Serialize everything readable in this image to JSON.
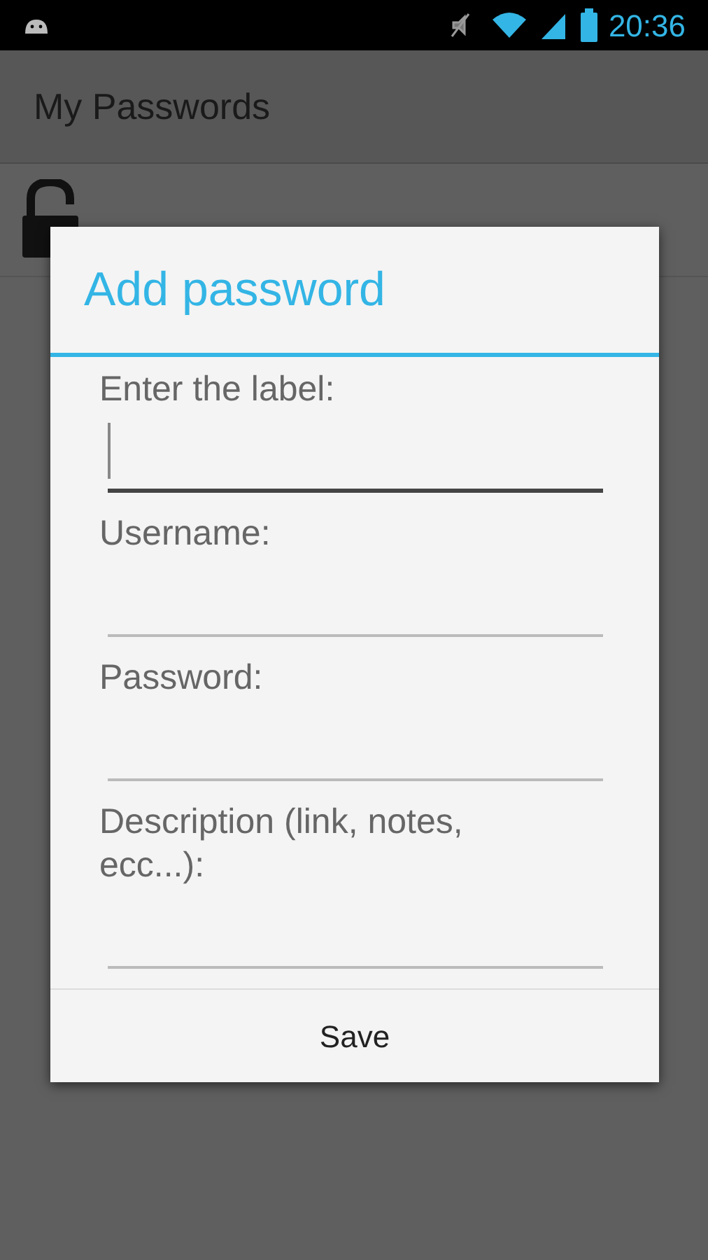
{
  "status_bar": {
    "time": "20:36"
  },
  "action_bar": {
    "title": "My Passwords"
  },
  "dialog": {
    "title": "Add password",
    "fields": [
      {
        "label": "Enter the label:",
        "focused": true
      },
      {
        "label": "Username:",
        "focused": false
      },
      {
        "label": "Password:",
        "focused": false
      },
      {
        "label": "Description (link, notes, ecc...):",
        "focused": false
      }
    ],
    "button": "Save"
  }
}
